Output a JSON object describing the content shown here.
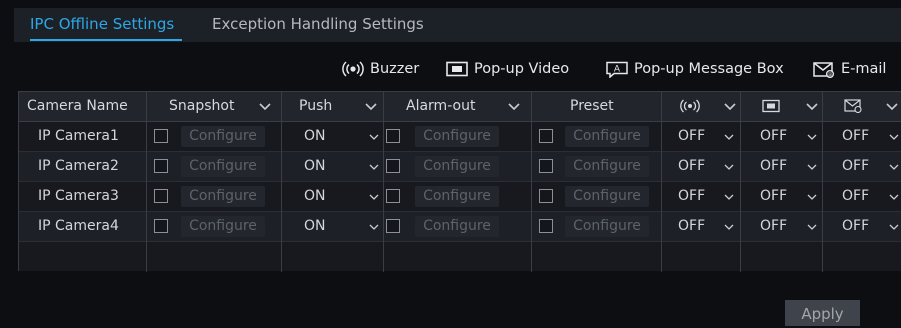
{
  "tabs": [
    {
      "label": "IPC Offline Settings"
    },
    {
      "label": "Exception Handling Settings"
    }
  ],
  "legend": {
    "buzzer": "Buzzer",
    "popup_video": "Pop-up Video",
    "popup_message": "Pop-up Message Box",
    "email": "E-mail"
  },
  "table": {
    "headers": {
      "camera_name": "Camera Name",
      "snapshot": "Snapshot",
      "push": "Push",
      "alarm_out": "Alarm-out",
      "preset": "Preset"
    },
    "configure_label": "Configure",
    "rows": [
      {
        "camera": "IP Camera1",
        "push": "ON",
        "buzzer": "OFF",
        "video": "OFF",
        "email": "OFF"
      },
      {
        "camera": "IP Camera2",
        "push": "ON",
        "buzzer": "OFF",
        "video": "OFF",
        "email": "OFF"
      },
      {
        "camera": "IP Camera3",
        "push": "ON",
        "buzzer": "OFF",
        "video": "OFF",
        "email": "OFF"
      },
      {
        "camera": "IP Camera4",
        "push": "ON",
        "buzzer": "OFF",
        "video": "OFF",
        "email": "OFF"
      }
    ]
  },
  "apply_label": "Apply",
  "colors": {
    "accent": "#2ea7e6",
    "background": "#0d0e12",
    "panel": "#17191f"
  }
}
